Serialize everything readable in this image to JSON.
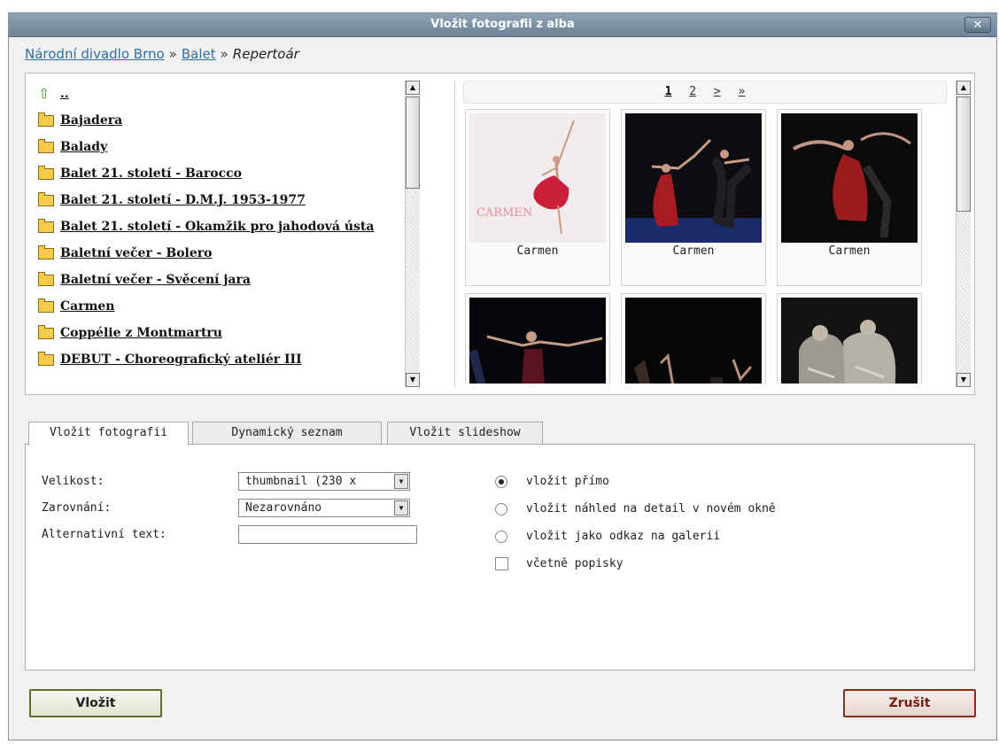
{
  "window": {
    "title": "Vložit fotografii z alba",
    "close_label": "✕"
  },
  "breadcrumb": {
    "items": [
      "Národní divadlo Brno",
      "Balet"
    ],
    "separator": "»",
    "current": "Repertoár"
  },
  "folders": {
    "up_label": "..",
    "items": [
      "Bajadera",
      "Balady",
      "Balet 21. století - Barocco",
      "Balet 21. století - D.M.J. 1953-1977",
      "Balet 21. století - Okamžik pro jahodová ústa",
      "Baletní večer - Bolero",
      "Baletní večer - Svěcení jara",
      "Carmen",
      "Coppélie z Montmartru",
      "DEBUT - Choreografický ateliér III"
    ]
  },
  "gallery": {
    "pager": [
      "1",
      "2",
      ">",
      "»"
    ],
    "current_page": "1",
    "photos": [
      {
        "caption": "Carmen",
        "poster_text": "CARMEN"
      },
      {
        "caption": "Carmen"
      },
      {
        "caption": "Carmen"
      },
      {
        "caption": ""
      },
      {
        "caption": ""
      },
      {
        "caption": ""
      }
    ]
  },
  "tabs": [
    "Vložit fotografii",
    "Dynamický seznam",
    "Vložit slideshow"
  ],
  "form": {
    "size_label": "Velikost:",
    "size_value": "thumbnail (230 x",
    "align_label": "Zarovnání:",
    "align_value": "Nezarovnáno",
    "alt_label": "Alternativní text:",
    "alt_value": ""
  },
  "options": {
    "direct": "vložit přímo",
    "preview": "vložit náhled na detail v novém okně",
    "link": "vložit jako odkaz na galerii",
    "caption": "včetně popisky",
    "selected": "direct"
  },
  "buttons": {
    "insert": "Vložit",
    "cancel": "Zrušit"
  }
}
